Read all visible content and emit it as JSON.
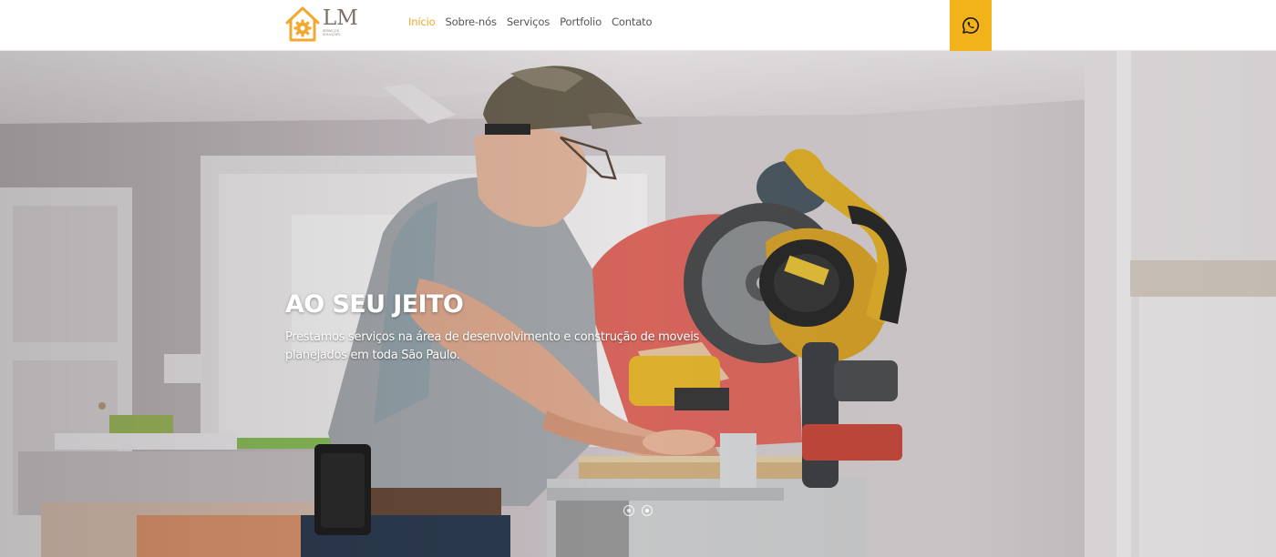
{
  "brand": {
    "letters": "LM",
    "subtitle": "Serviços Soluções",
    "accent_color": "#f0a82e",
    "icon": "house-gear-icon"
  },
  "nav": {
    "items": [
      {
        "label": "Início",
        "active": true
      },
      {
        "label": "Sobre-nós",
        "active": false
      },
      {
        "label": "Serviços",
        "active": false
      },
      {
        "label": "Portfolio",
        "active": false
      },
      {
        "label": "Contato",
        "active": false
      }
    ]
  },
  "whatsapp": {
    "icon": "whatsapp-icon",
    "color": "#f2b31a"
  },
  "hero": {
    "title": "AO SEU JEITO",
    "description": "Prestamos serviços na área de desenvolvimento e construção de moveis planejados em toda São Paulo.",
    "slides_count": 2,
    "active_slide": 2,
    "background": "photo of two carpenters cutting wood with a miter saw"
  }
}
